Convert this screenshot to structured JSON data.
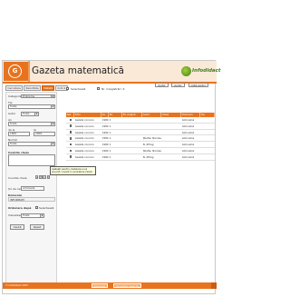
{
  "header": {
    "title": "Gazeta matematică",
    "brand": "Infodidact",
    "logo_glyph": "G"
  },
  "tabs": [
    "Cercetare",
    "Rezultate",
    "Detalii",
    "Indicii"
  ],
  "active_tab": 2,
  "topbar": {
    "selectall_label": "Selectează",
    "nr_label": "Nr. înregistrări: 9",
    "buttons": [
      "Ajutor",
      "Ajutor",
      "Listă pentru"
    ]
  },
  "filters": {
    "categorie_label": "Categorie",
    "categorie_value": "Probleme",
    "tip_label": "Tip",
    "tip_value": "Toate",
    "autor_label": "Autor",
    "autor_value": "Toate",
    "an_label": "An",
    "an_value": "Toate",
    "interval_labels": [
      "de la",
      "la"
    ],
    "from_value": "1900",
    "to_value": "2006",
    "numar_label": "Număr",
    "numar_value": "Toate",
    "kw_label": "Cuvinte cheie",
    "keys_label": "Cuvinte cheie",
    "keys": [
      "A",
      "B",
      "C",
      "D"
    ],
    "sir_label": "Șir de caractere",
    "sir_value": "Arhimede",
    "domeniu_label": "Domeniu",
    "info_text": "INFORMAȚII",
    "sort_label": "Ordonare după",
    "sort_check_label": "Selectează",
    "vizualizare_label": "Vizualizare",
    "vizualizare_value": "Toate",
    "btn_cauta": "Caută",
    "btn_reset": "Reset"
  },
  "tooltip": "Apăsați pentru căutarea unui anumit cuvânt în probleme (SAU) rămâne așa fără limită de cuvânt",
  "grid": {
    "headers": [
      "Sel.",
      "Titlu",
      "An",
      "Nr.",
      "Nr. pagină",
      "Autor",
      "Clasa",
      "Domeniu",
      "Tip"
    ],
    "rows": [
      {
        "title": "Gazeta concurs",
        "an": "1980",
        "nr": "1",
        "pag": "",
        "autor": "",
        "dom": "Gimnaziul"
      },
      {
        "title": "Gazeta concurs",
        "an": "1980",
        "nr": "1",
        "pag": "",
        "autor": "",
        "dom": "Gimnaziul"
      },
      {
        "title": "Gazeta concurs",
        "an": "1980",
        "nr": "1",
        "pag": "",
        "autor": "",
        "dom": "Gimnaziul"
      },
      {
        "title": "Gazeta concurs",
        "an": "1980",
        "nr": "1",
        "pag": "",
        "autor": "Știefan Nicolescu",
        "dom": "Gimnaziul"
      },
      {
        "title": "Gazeta concurs",
        "an": "1980",
        "nr": "1",
        "pag": "",
        "autor": "N. Zifrag",
        "dom": "Gimnaziul"
      },
      {
        "title": "Gazeta concurs",
        "an": "1980",
        "nr": "1",
        "pag": "",
        "autor": "Știefan Nicolescu",
        "dom": "Gimnaziul"
      },
      {
        "title": "Gazeta concurs",
        "an": "1980",
        "nr": "1",
        "pag": "",
        "autor": "N. Zifrag",
        "dom": "Gimnaziul"
      }
    ]
  },
  "footer": {
    "text": "© InfoDidact 2007",
    "buttons": [
      "Rezultate",
      "Vizualizări selecție"
    ]
  },
  "colors": {
    "accent": "#e8731e",
    "header_bg": "#fbe9d8",
    "tooltip_bg": "#ffffe1"
  }
}
